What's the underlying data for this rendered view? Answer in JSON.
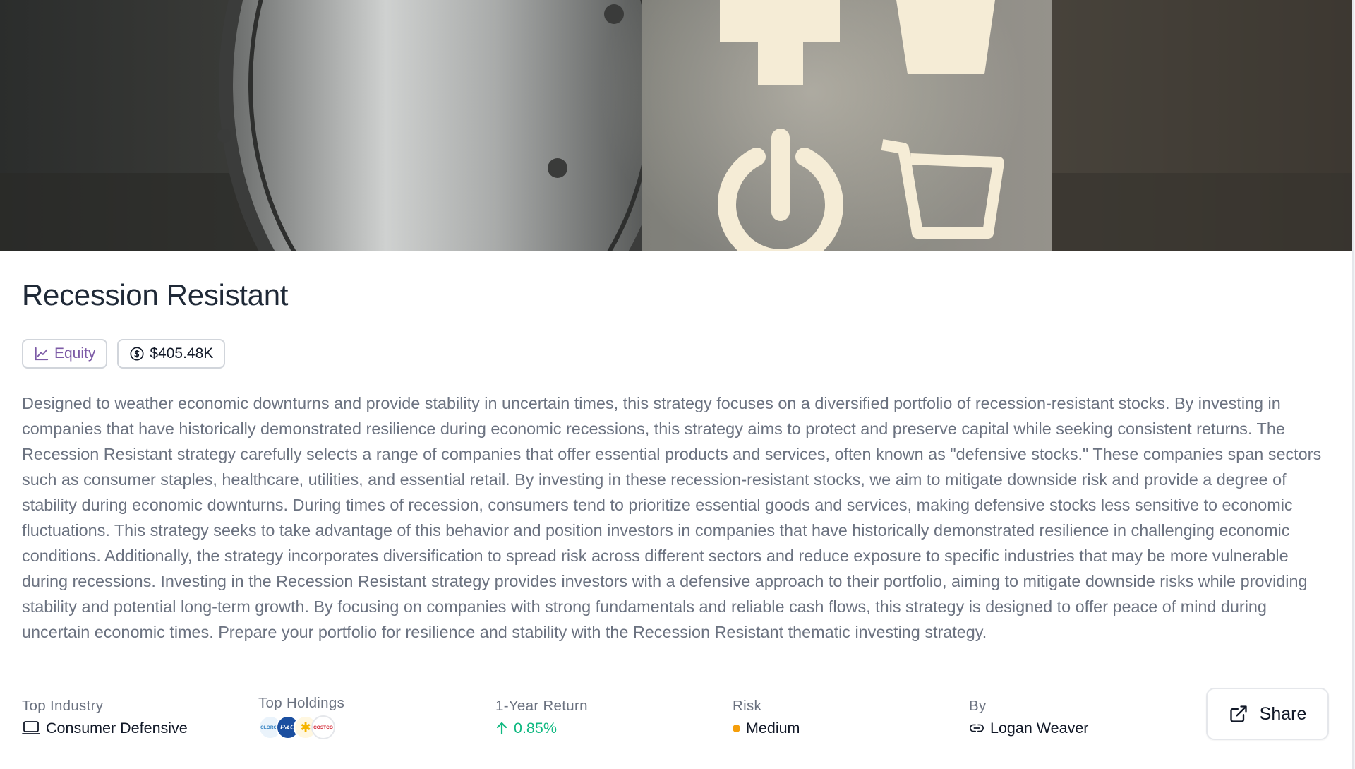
{
  "strategy": {
    "title": "Recession Resistant",
    "tags": {
      "type_label": "Equity",
      "aum_label": "$405.48K"
    },
    "description": "Designed to weather economic downturns and provide stability in uncertain times, this strategy focuses on a diversified portfolio of recession-resistant stocks. By investing in companies that have historically demonstrated resilience during economic recessions, this strategy aims to protect and preserve capital while seeking consistent returns. The Recession Resistant strategy carefully selects a range of companies that offer essential products and services, often known as \"defensive stocks.\" These companies span sectors such as consumer staples, healthcare, utilities, and essential retail. By investing in these recession-resistant stocks, we aim to mitigate downside risk and provide a degree of stability during economic downturns. During times of recession, consumers tend to prioritize essential goods and services, making defensive stocks less sensitive to economic fluctuations. This strategy seeks to take advantage of this behavior and position investors in companies that have historically demonstrated resilience in challenging economic conditions. Additionally, the strategy incorporates diversification to spread risk across different sectors and reduce exposure to specific industries that may be more vulnerable during recessions. Investing in the Recession Resistant strategy provides investors with a defensive approach to their portfolio, aiming to mitigate downside risks while providing stability and potential long-term growth. By focusing on companies with strong fundamentals and reliable cash flows, this strategy is designed to offer peace of mind during uncertain economic times. Prepare your portfolio for resilience and stability with the Recession Resistant thematic investing strategy."
  },
  "meta": {
    "top_industry": {
      "label": "Top Industry",
      "value": "Consumer Defensive",
      "icon": "laptop-icon"
    },
    "top_holdings": {
      "label": "Top Holdings",
      "logos": [
        {
          "name": "Clorox",
          "text": "CLOROX",
          "color": "#2f7fc1"
        },
        {
          "name": "P&G",
          "text": "P&G",
          "color": "#1b4fa0"
        },
        {
          "name": "Walmart",
          "text": "✱",
          "color": "#f5b400"
        },
        {
          "name": "Costco",
          "text": "COSTCO",
          "color": "#d0202e"
        }
      ]
    },
    "one_year_return": {
      "label": "1-Year Return",
      "value": "0.85%",
      "icon": "arrow-up-icon",
      "color": "#10b981"
    },
    "risk": {
      "label": "Risk",
      "value": "Medium",
      "dot_color": "#f59e0b"
    },
    "by": {
      "label": "By",
      "value": "Logan Weaver",
      "icon": "link-icon"
    }
  },
  "share": {
    "label": "Share",
    "icon": "external-link-icon"
  },
  "colors": {
    "equity_tag": "#7c5aa6",
    "text_muted": "#6b7280",
    "positive": "#10b981"
  }
}
